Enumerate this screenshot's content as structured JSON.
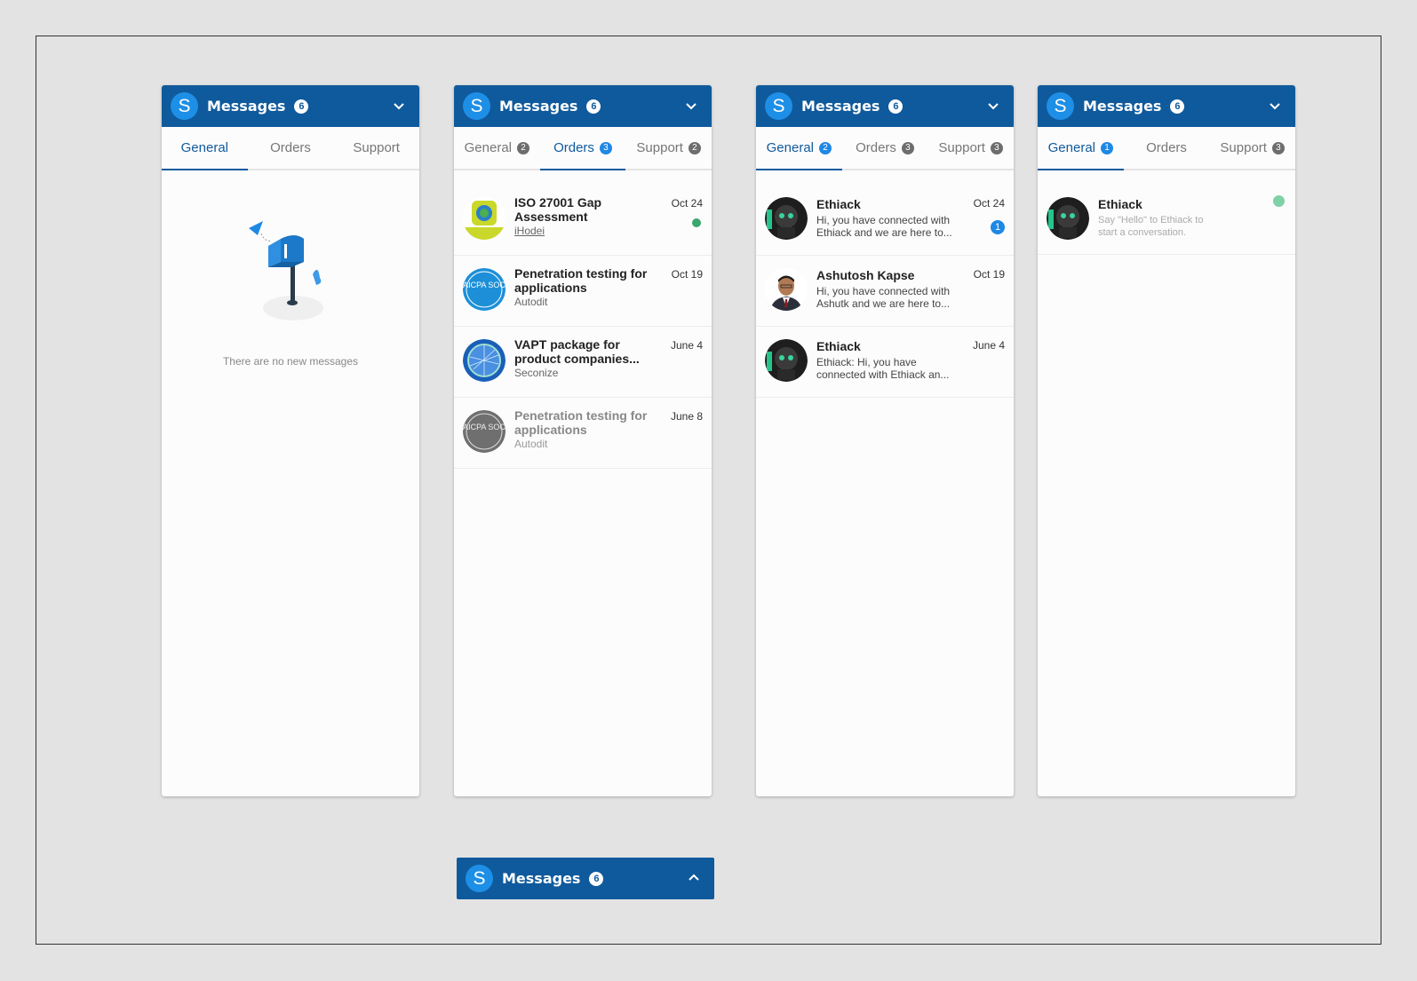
{
  "header": {
    "logo_letter": "S",
    "title": "Messages",
    "count": "6"
  },
  "panel1": {
    "tabs": [
      {
        "label": "General"
      },
      {
        "label": "Orders"
      },
      {
        "label": "Support"
      }
    ],
    "empty_text": "There are no new messages"
  },
  "panel2": {
    "tabs": [
      {
        "label": "General",
        "badge": "2"
      },
      {
        "label": "Orders",
        "badge": "3"
      },
      {
        "label": "Support",
        "badge": "2"
      }
    ],
    "rows": [
      {
        "title": "ISO 27001 Gap Assessment",
        "vendor": "iHodei",
        "date": "Oct 24",
        "avatar_icon": "iso-badge-icon"
      },
      {
        "title": "Penetration testing for applications",
        "vendor": "Autodit",
        "date": "Oct 19",
        "avatar_icon": "aicpa-soc-icon",
        "avatar_text": "AICPA SOC"
      },
      {
        "title": "VAPT package for product companies...",
        "vendor": "Seconize",
        "date": "June 4",
        "avatar_icon": "globe-network-icon"
      },
      {
        "title": "Penetration testing for applications",
        "vendor": "Autodit",
        "date": "June 8",
        "avatar_icon": "aicpa-soc-icon",
        "avatar_text": "AICPA SOC"
      }
    ]
  },
  "panel3": {
    "tabs": [
      {
        "label": "General",
        "badge": "2"
      },
      {
        "label": "Orders",
        "badge": "3"
      },
      {
        "label": "Support",
        "badge": "3"
      }
    ],
    "rows": [
      {
        "name": "Ethiack",
        "message": "Hi, you have connected with Ethiack and we are here to...",
        "date": "Oct 24",
        "unread": "1"
      },
      {
        "name": "Ashutosh Kapse",
        "message": "Hi, you have connected with Ashutk and we are here to...",
        "date": "Oct 19"
      },
      {
        "name": "Ethiack",
        "message": "Ethiack: Hi, you have connected with Ethiack an...",
        "date": "June 4"
      }
    ]
  },
  "panel4": {
    "tabs": [
      {
        "label": "General",
        "badge": "1"
      },
      {
        "label": "Orders"
      },
      {
        "label": "Support",
        "badge": "3"
      }
    ],
    "rows": [
      {
        "name": "Ethiack",
        "message": "Say \"Hello\" to Ethiack to start a conversation."
      }
    ]
  },
  "colors": {
    "header": "#0f5a9c",
    "accent": "#1e88e5",
    "online": "#3aa76d"
  }
}
